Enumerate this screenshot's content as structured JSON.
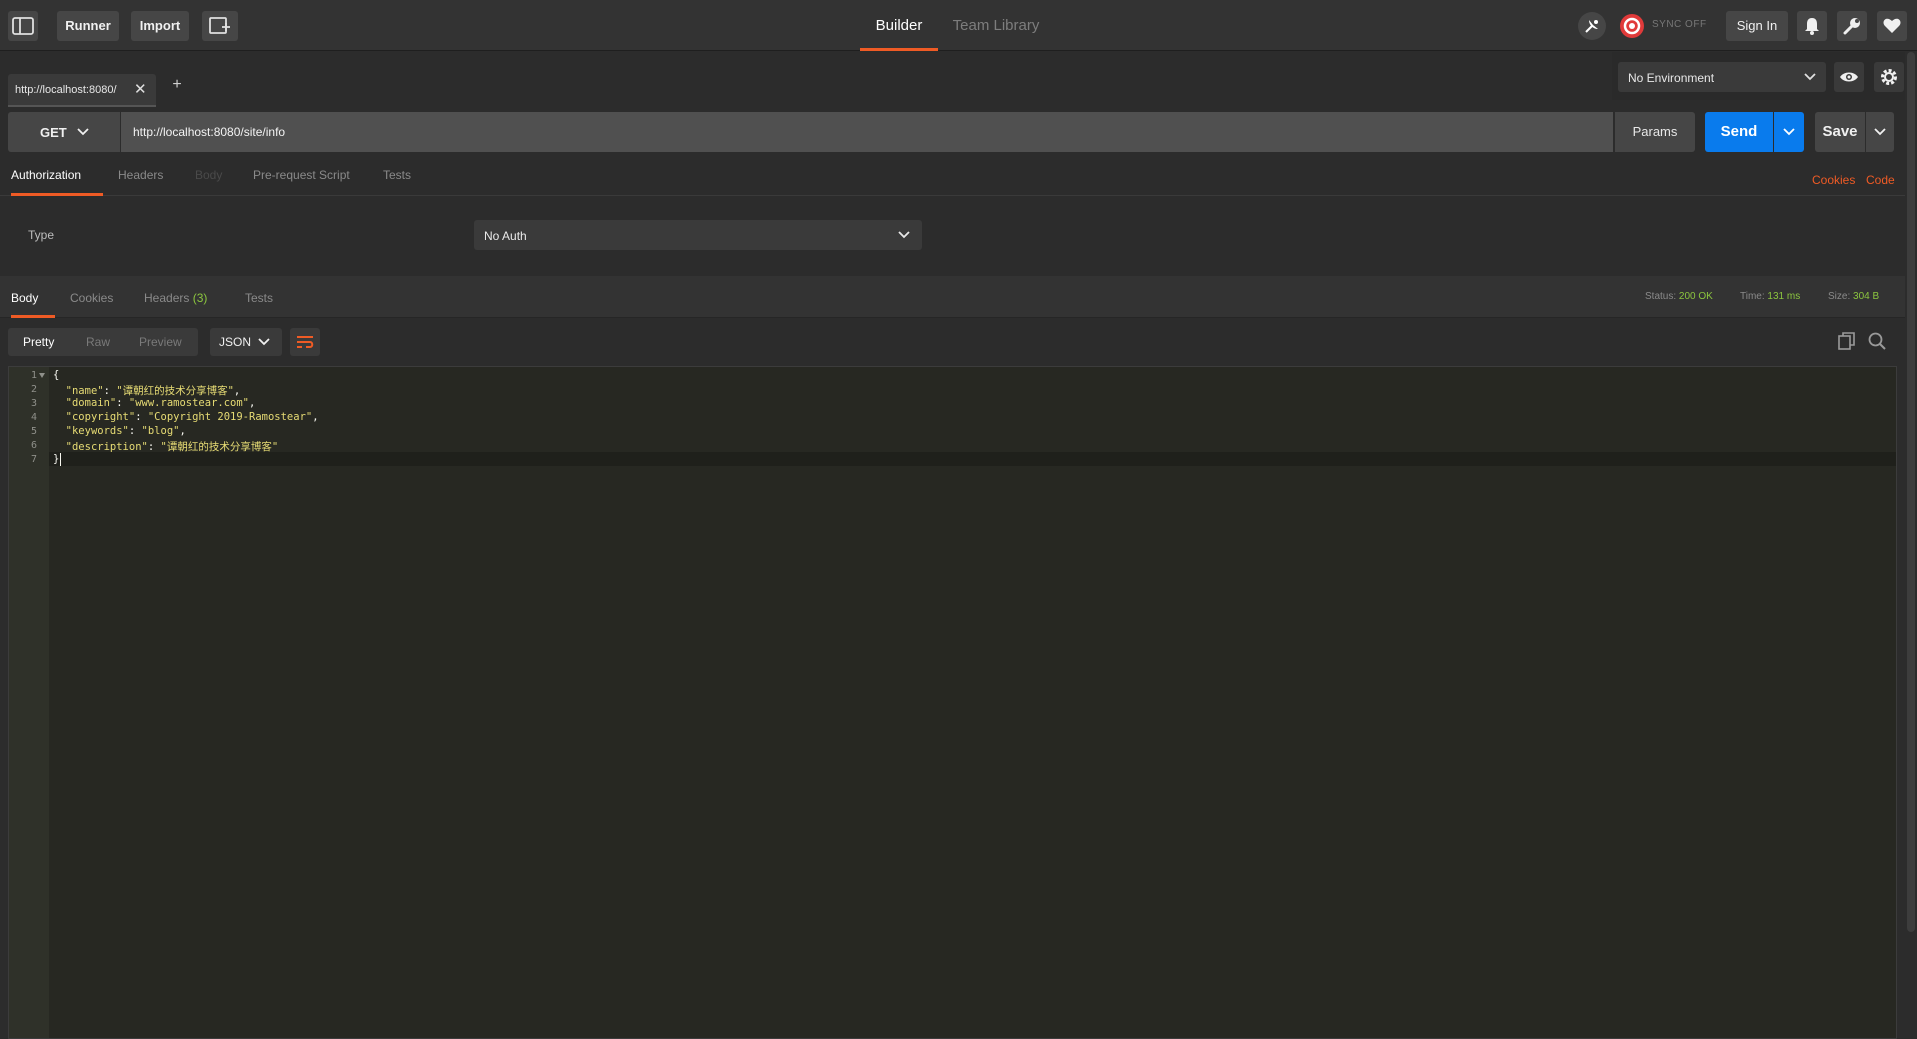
{
  "header": {
    "runner_label": "Runner",
    "import_label": "Import",
    "tabs": [
      {
        "label": "Builder",
        "active": true
      },
      {
        "label": "Team Library",
        "active": false
      }
    ],
    "sync_label": "SYNC OFF",
    "signin_label": "Sign In",
    "accent_color": "#ef5b25"
  },
  "request_tab": {
    "label": "http://localhost:8080/",
    "close_icon": "close-icon",
    "new_tab_label": "+"
  },
  "environment": {
    "selected": "No Environment"
  },
  "request": {
    "method": "GET",
    "url": "http://localhost:8080/site/info",
    "params_label": "Params",
    "send_label": "Send",
    "save_label": "Save",
    "send_color": "#097bed"
  },
  "request_tabs": {
    "items": [
      {
        "label": "Authorization",
        "state": "active"
      },
      {
        "label": "Headers",
        "state": "inactive"
      },
      {
        "label": "Body",
        "state": "disabled"
      },
      {
        "label": "Pre-request Script",
        "state": "inactive"
      },
      {
        "label": "Tests",
        "state": "inactive"
      }
    ],
    "cookies_link": "Cookies",
    "code_link": "Code"
  },
  "auth": {
    "type_label": "Type",
    "selected": "No Auth"
  },
  "response": {
    "tabs": [
      {
        "label": "Body",
        "active": true
      },
      {
        "label": "Cookies",
        "active": false
      },
      {
        "label": "Headers",
        "count": "(3)",
        "active": false
      },
      {
        "label": "Tests",
        "active": false
      }
    ],
    "status_label": "Status:",
    "status_value": "200 OK",
    "time_label": "Time:",
    "time_value": "131 ms",
    "size_label": "Size:",
    "size_value": "304 B",
    "views": [
      {
        "label": "Pretty",
        "active": true
      },
      {
        "label": "Raw",
        "active": false
      },
      {
        "label": "Preview",
        "active": false
      }
    ],
    "format": "JSON",
    "body_lines": [
      {
        "num": "1",
        "text": "{"
      },
      {
        "num": "2",
        "key": "\"name\"",
        "value": "\"谭朝红的技术分享博客\"",
        "trail": ","
      },
      {
        "num": "3",
        "key": "\"domain\"",
        "value": "\"www.ramostear.com\"",
        "trail": ","
      },
      {
        "num": "4",
        "key": "\"copyright\"",
        "value": "\"Copyright 2019-Ramostear\"",
        "trail": ","
      },
      {
        "num": "5",
        "key": "\"keywords\"",
        "value": "\"blog\"",
        "trail": ","
      },
      {
        "num": "6",
        "key": "\"description\"",
        "value": "\"谭朝红的技术分享博客\"",
        "trail": ""
      },
      {
        "num": "7",
        "text": "}"
      }
    ]
  }
}
